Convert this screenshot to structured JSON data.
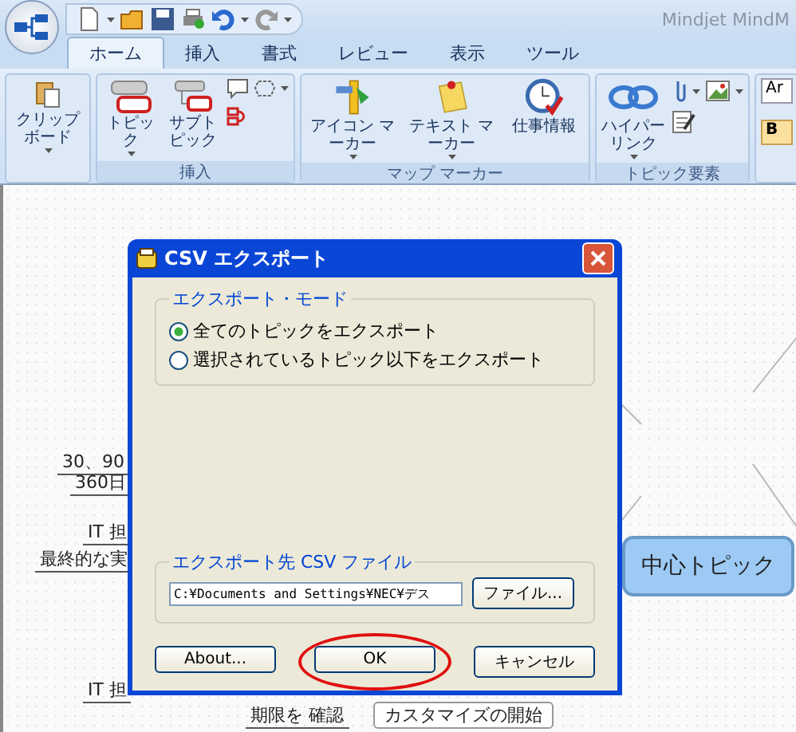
{
  "app": {
    "title": "Mindjet MindM"
  },
  "tabs": [
    {
      "label": "ホーム",
      "selected": true
    },
    {
      "label": "挿入",
      "selected": false
    },
    {
      "label": "書式",
      "selected": false
    },
    {
      "label": "レビュー",
      "selected": false
    },
    {
      "label": "表示",
      "selected": false
    },
    {
      "label": "ツール",
      "selected": false
    }
  ],
  "ribbon": {
    "groups": [
      {
        "items": [
          {
            "kind": "clipboard",
            "label": "クリップボード",
            "dropdown": true
          }
        ]
      },
      {
        "label": "挿入",
        "items": [
          {
            "kind": "topic",
            "label": "トピック",
            "dropdown": true
          },
          {
            "kind": "subtopic",
            "label": "サブトピック",
            "dropdown": false
          },
          {
            "kind": "small-insert",
            "dropdown": true
          }
        ]
      },
      {
        "label": "マップ マーカー",
        "items": [
          {
            "kind": "pin",
            "label": "アイコン マーカー",
            "dropdown": true
          },
          {
            "kind": "note",
            "label": "テキスト マーカー",
            "dropdown": true
          },
          {
            "kind": "clock",
            "label": "仕事情報",
            "dropdown": false
          }
        ]
      },
      {
        "label": "トピック要素",
        "items": [
          {
            "kind": "link",
            "label": "ハイパーリンク",
            "dropdown": true
          },
          {
            "kind": "small-attach",
            "dropdown": true
          }
        ]
      },
      {
        "items": [
          {
            "kind": "font",
            "label": "Ar"
          },
          {
            "kind": "bold",
            "label": "B"
          }
        ]
      }
    ]
  },
  "canvas": {
    "topics": [
      {
        "kind": "subtopic",
        "text": "30、90"
      },
      {
        "kind": "subtopic",
        "text": "360日"
      },
      {
        "kind": "subtopic",
        "text": "IT 担"
      },
      {
        "kind": "subtopic",
        "text": "最終的な実"
      },
      {
        "kind": "subtopic",
        "text": "IT 担"
      },
      {
        "kind": "subtopic",
        "text": "期限を 確認"
      },
      {
        "kind": "boxed",
        "text": "カスタマイズの開始"
      },
      {
        "kind": "central",
        "text": "中心トピック"
      }
    ]
  },
  "dialog": {
    "title": "CSV エクスポート",
    "mode_group": {
      "label": "エクスポート・モード",
      "options": [
        {
          "label": "全てのトピックをエクスポート",
          "selected": true
        },
        {
          "label": "選択されているトピック以下をエクスポート",
          "selected": false
        }
      ]
    },
    "file_group": {
      "label": "エクスポート先 CSV ファイル",
      "value": "C:¥Documents and Settings¥NEC¥デス",
      "browse": "ファイル..."
    },
    "buttons": [
      {
        "label": "About...",
        "highlighted": false
      },
      {
        "label": "OK",
        "highlighted": true
      },
      {
        "label": "キャンセル",
        "highlighted": false
      }
    ]
  }
}
